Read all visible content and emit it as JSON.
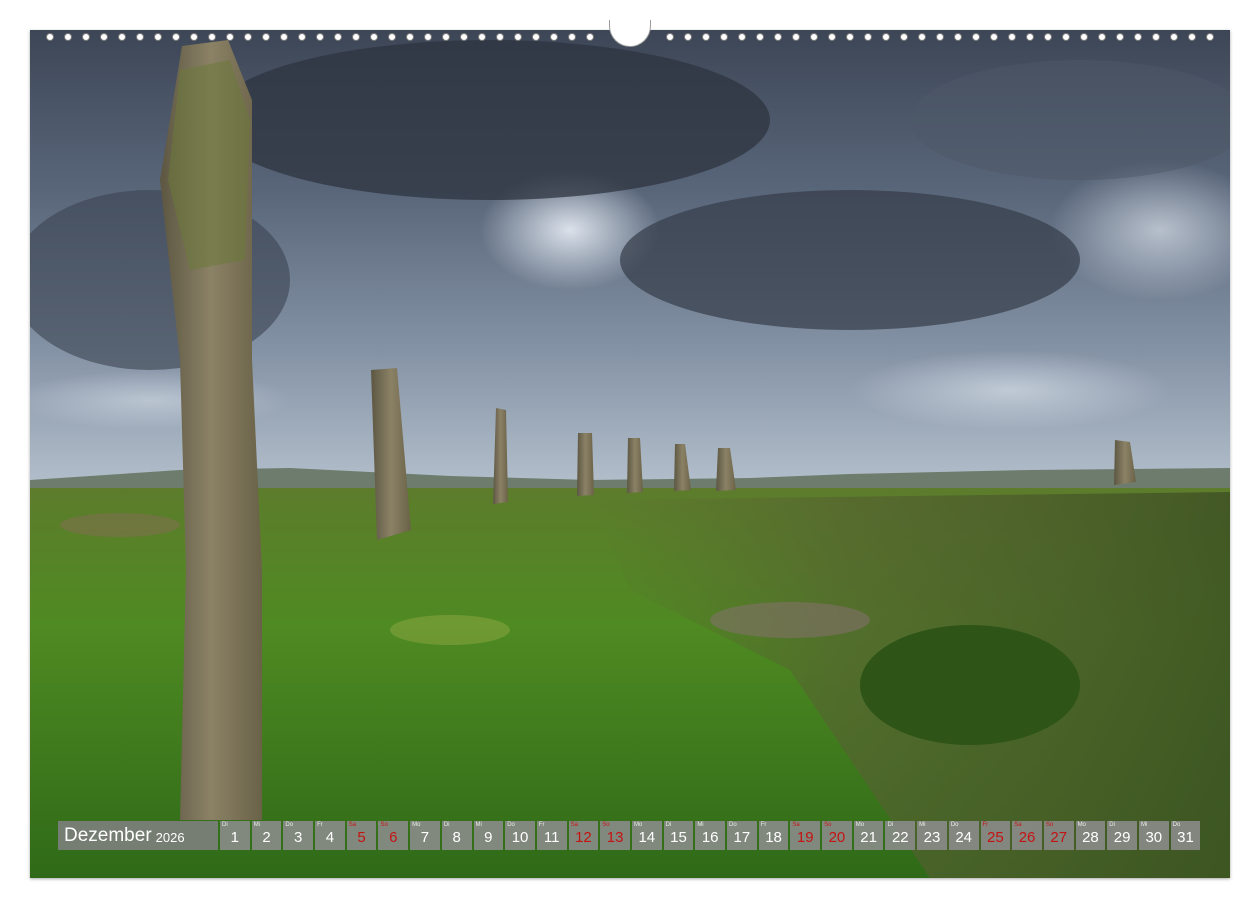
{
  "calendar": {
    "month": "Dezember",
    "year": "2026",
    "days": [
      {
        "abbr": "Di",
        "num": "1",
        "weekend": false
      },
      {
        "abbr": "Mi",
        "num": "2",
        "weekend": false
      },
      {
        "abbr": "Do",
        "num": "3",
        "weekend": false
      },
      {
        "abbr": "Fr",
        "num": "4",
        "weekend": false
      },
      {
        "abbr": "Sa",
        "num": "5",
        "weekend": true
      },
      {
        "abbr": "So",
        "num": "6",
        "weekend": true
      },
      {
        "abbr": "Mo",
        "num": "7",
        "weekend": false
      },
      {
        "abbr": "Di",
        "num": "8",
        "weekend": false
      },
      {
        "abbr": "Mi",
        "num": "9",
        "weekend": false
      },
      {
        "abbr": "Do",
        "num": "10",
        "weekend": false
      },
      {
        "abbr": "Fr",
        "num": "11",
        "weekend": false
      },
      {
        "abbr": "Sa",
        "num": "12",
        "weekend": true
      },
      {
        "abbr": "So",
        "num": "13",
        "weekend": true
      },
      {
        "abbr": "Mo",
        "num": "14",
        "weekend": false
      },
      {
        "abbr": "Di",
        "num": "15",
        "weekend": false
      },
      {
        "abbr": "Mi",
        "num": "16",
        "weekend": false
      },
      {
        "abbr": "Do",
        "num": "17",
        "weekend": false
      },
      {
        "abbr": "Fr",
        "num": "18",
        "weekend": false
      },
      {
        "abbr": "Sa",
        "num": "19",
        "weekend": true
      },
      {
        "abbr": "So",
        "num": "20",
        "weekend": true
      },
      {
        "abbr": "Mo",
        "num": "21",
        "weekend": false
      },
      {
        "abbr": "Di",
        "num": "22",
        "weekend": false
      },
      {
        "abbr": "Mi",
        "num": "23",
        "weekend": false
      },
      {
        "abbr": "Do",
        "num": "24",
        "weekend": false
      },
      {
        "abbr": "Fr",
        "num": "25",
        "weekend": true
      },
      {
        "abbr": "Sa",
        "num": "26",
        "weekend": true
      },
      {
        "abbr": "So",
        "num": "27",
        "weekend": true
      },
      {
        "abbr": "Mo",
        "num": "28",
        "weekend": false
      },
      {
        "abbr": "Di",
        "num": "29",
        "weekend": false
      },
      {
        "abbr": "Mi",
        "num": "30",
        "weekend": false
      },
      {
        "abbr": "Do",
        "num": "31",
        "weekend": false
      }
    ]
  },
  "photo": {
    "subject": "standing stones on grass moorland under a stormy sky"
  },
  "colors": {
    "weekend_text": "#c41313",
    "strip_background": "#8c8c8c"
  }
}
